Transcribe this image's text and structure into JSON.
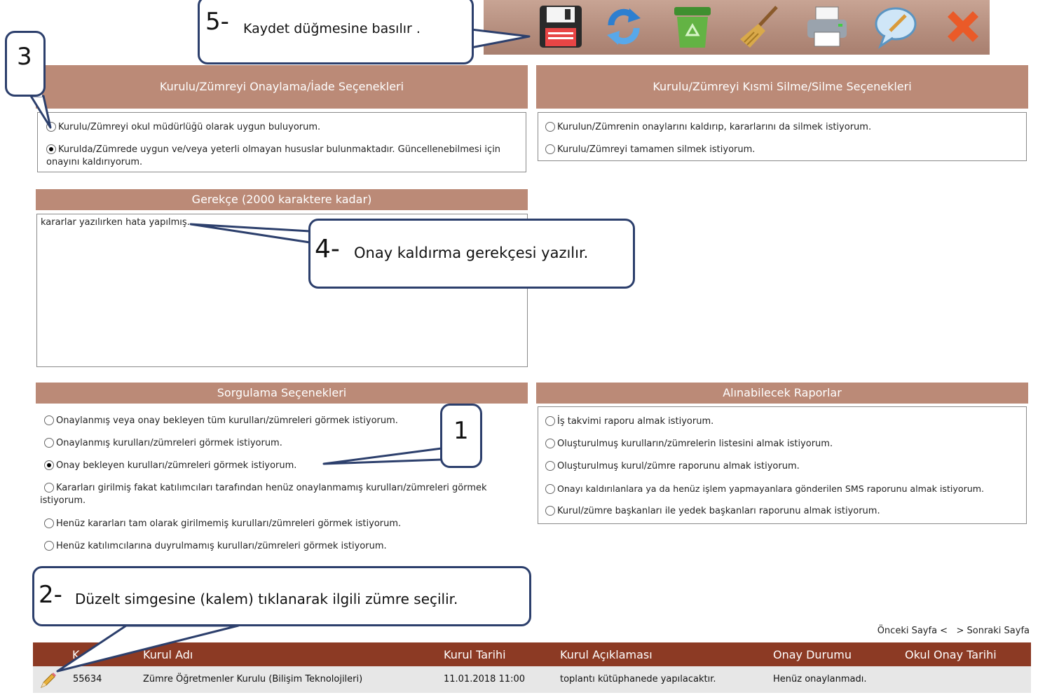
{
  "toolbar": {
    "icons": [
      "save-icon",
      "refresh-icon",
      "recycle-bin-icon",
      "broom-icon",
      "printer-icon",
      "comment-icon",
      "close-icon"
    ]
  },
  "approval": {
    "header": "Kurulu/Zümreyi Onaylama/İade Seçenekleri",
    "options": [
      {
        "label": "Kurulu/Zümreyi okul müdürlüğü olarak uygun buluyorum.",
        "selected": false
      },
      {
        "label": "Kurulda/Zümrede uygun ve/veya yeterli olmayan hususlar bulunmaktadır. Güncellenebilmesi için onayını kaldırıyorum.",
        "selected": true
      }
    ]
  },
  "deletion": {
    "header": "Kurulu/Zümreyi Kısmi Silme/Silme Seçenekleri",
    "options": [
      {
        "label": "Kurulun/Zümrenin onaylarını kaldırıp, kararlarını da silmek istiyorum.",
        "selected": false
      },
      {
        "label": "Kurulu/Zümreyi tamamen silmek istiyorum.",
        "selected": false
      }
    ]
  },
  "reason": {
    "header": "Gerekçe (2000 karaktere kadar)",
    "value": "kararlar yazılırken hata yapılmış."
  },
  "query": {
    "header": "Sorgulama Seçenekleri",
    "options": [
      {
        "label": "Onaylanmış veya onay bekleyen tüm kurulları/zümreleri görmek istiyorum.",
        "selected": false
      },
      {
        "label": "Onaylanmış kurulları/zümreleri görmek istiyorum.",
        "selected": false
      },
      {
        "label": "Onay bekleyen kurulları/zümreleri görmek istiyorum.",
        "selected": true
      },
      {
        "label": "Kararları girilmiş fakat katılımcıları tarafından henüz onaylanmamış kurulları/zümreleri görmek istiyorum.",
        "selected": false
      },
      {
        "label": "Henüz kararları tam olarak girilmemiş kurulları/zümreleri görmek istiyorum.",
        "selected": false
      },
      {
        "label": "Henüz katılımcılarına duyrulmamış kurulları/zümreleri görmek istiyorum.",
        "selected": false
      }
    ]
  },
  "reports": {
    "header": "Alınabilecek Raporlar",
    "options": [
      {
        "label": "İş takvimi raporu almak istiyorum.",
        "selected": false
      },
      {
        "label": "Oluşturulmuş kurulların/zümrelerin listesini almak istiyorum.",
        "selected": false
      },
      {
        "label": "Oluşturulmuş kurul/zümre raporunu almak istiyorum.",
        "selected": false
      },
      {
        "label": "Onayı kaldırılanlara ya da henüz işlem yapmayanlara gönderilen SMS raporunu almak istiyorum.",
        "selected": false
      },
      {
        "label": "Kurul/zümre başkanları ile yedek başkanları raporunu almak istiyorum.",
        "selected": false
      }
    ]
  },
  "callouts": {
    "c1": {
      "num": "1",
      "text": ""
    },
    "c2": {
      "num": "2-",
      "text": "Düzelt simgesine (kalem) tıklanarak ilgili zümre seçilir."
    },
    "c3": {
      "num": "3",
      "text": ""
    },
    "c4": {
      "num": "4-",
      "text": "Onay kaldırma gerekçesi yazılır."
    },
    "c5": {
      "num": "5-",
      "text": "Kaydet düğmesine basılır ."
    }
  },
  "pager": {
    "prev": "Önceki Sayfa <",
    "next": "> Sonraki Sayfa"
  },
  "table": {
    "headers": [
      "K",
      "Kurul Adı",
      "Kurul Tarihi",
      "Kurul Açıklaması",
      "Onay Durumu",
      "Okul Onay Tarihi"
    ],
    "rows": [
      {
        "id": "55634",
        "name": "Zümre Öğretmenler Kurulu (Bilişim Teknolojileri)",
        "date": "11.01.2018 11:00",
        "desc": "toplantı kütüphanede yapılacaktır.",
        "status": "Henüz onaylanmadı.",
        "school_date": ""
      }
    ]
  },
  "colors": {
    "header_bg": "#bb8a77",
    "table_header_bg": "#8c3a24",
    "callout_border": "#2c3f6c"
  }
}
